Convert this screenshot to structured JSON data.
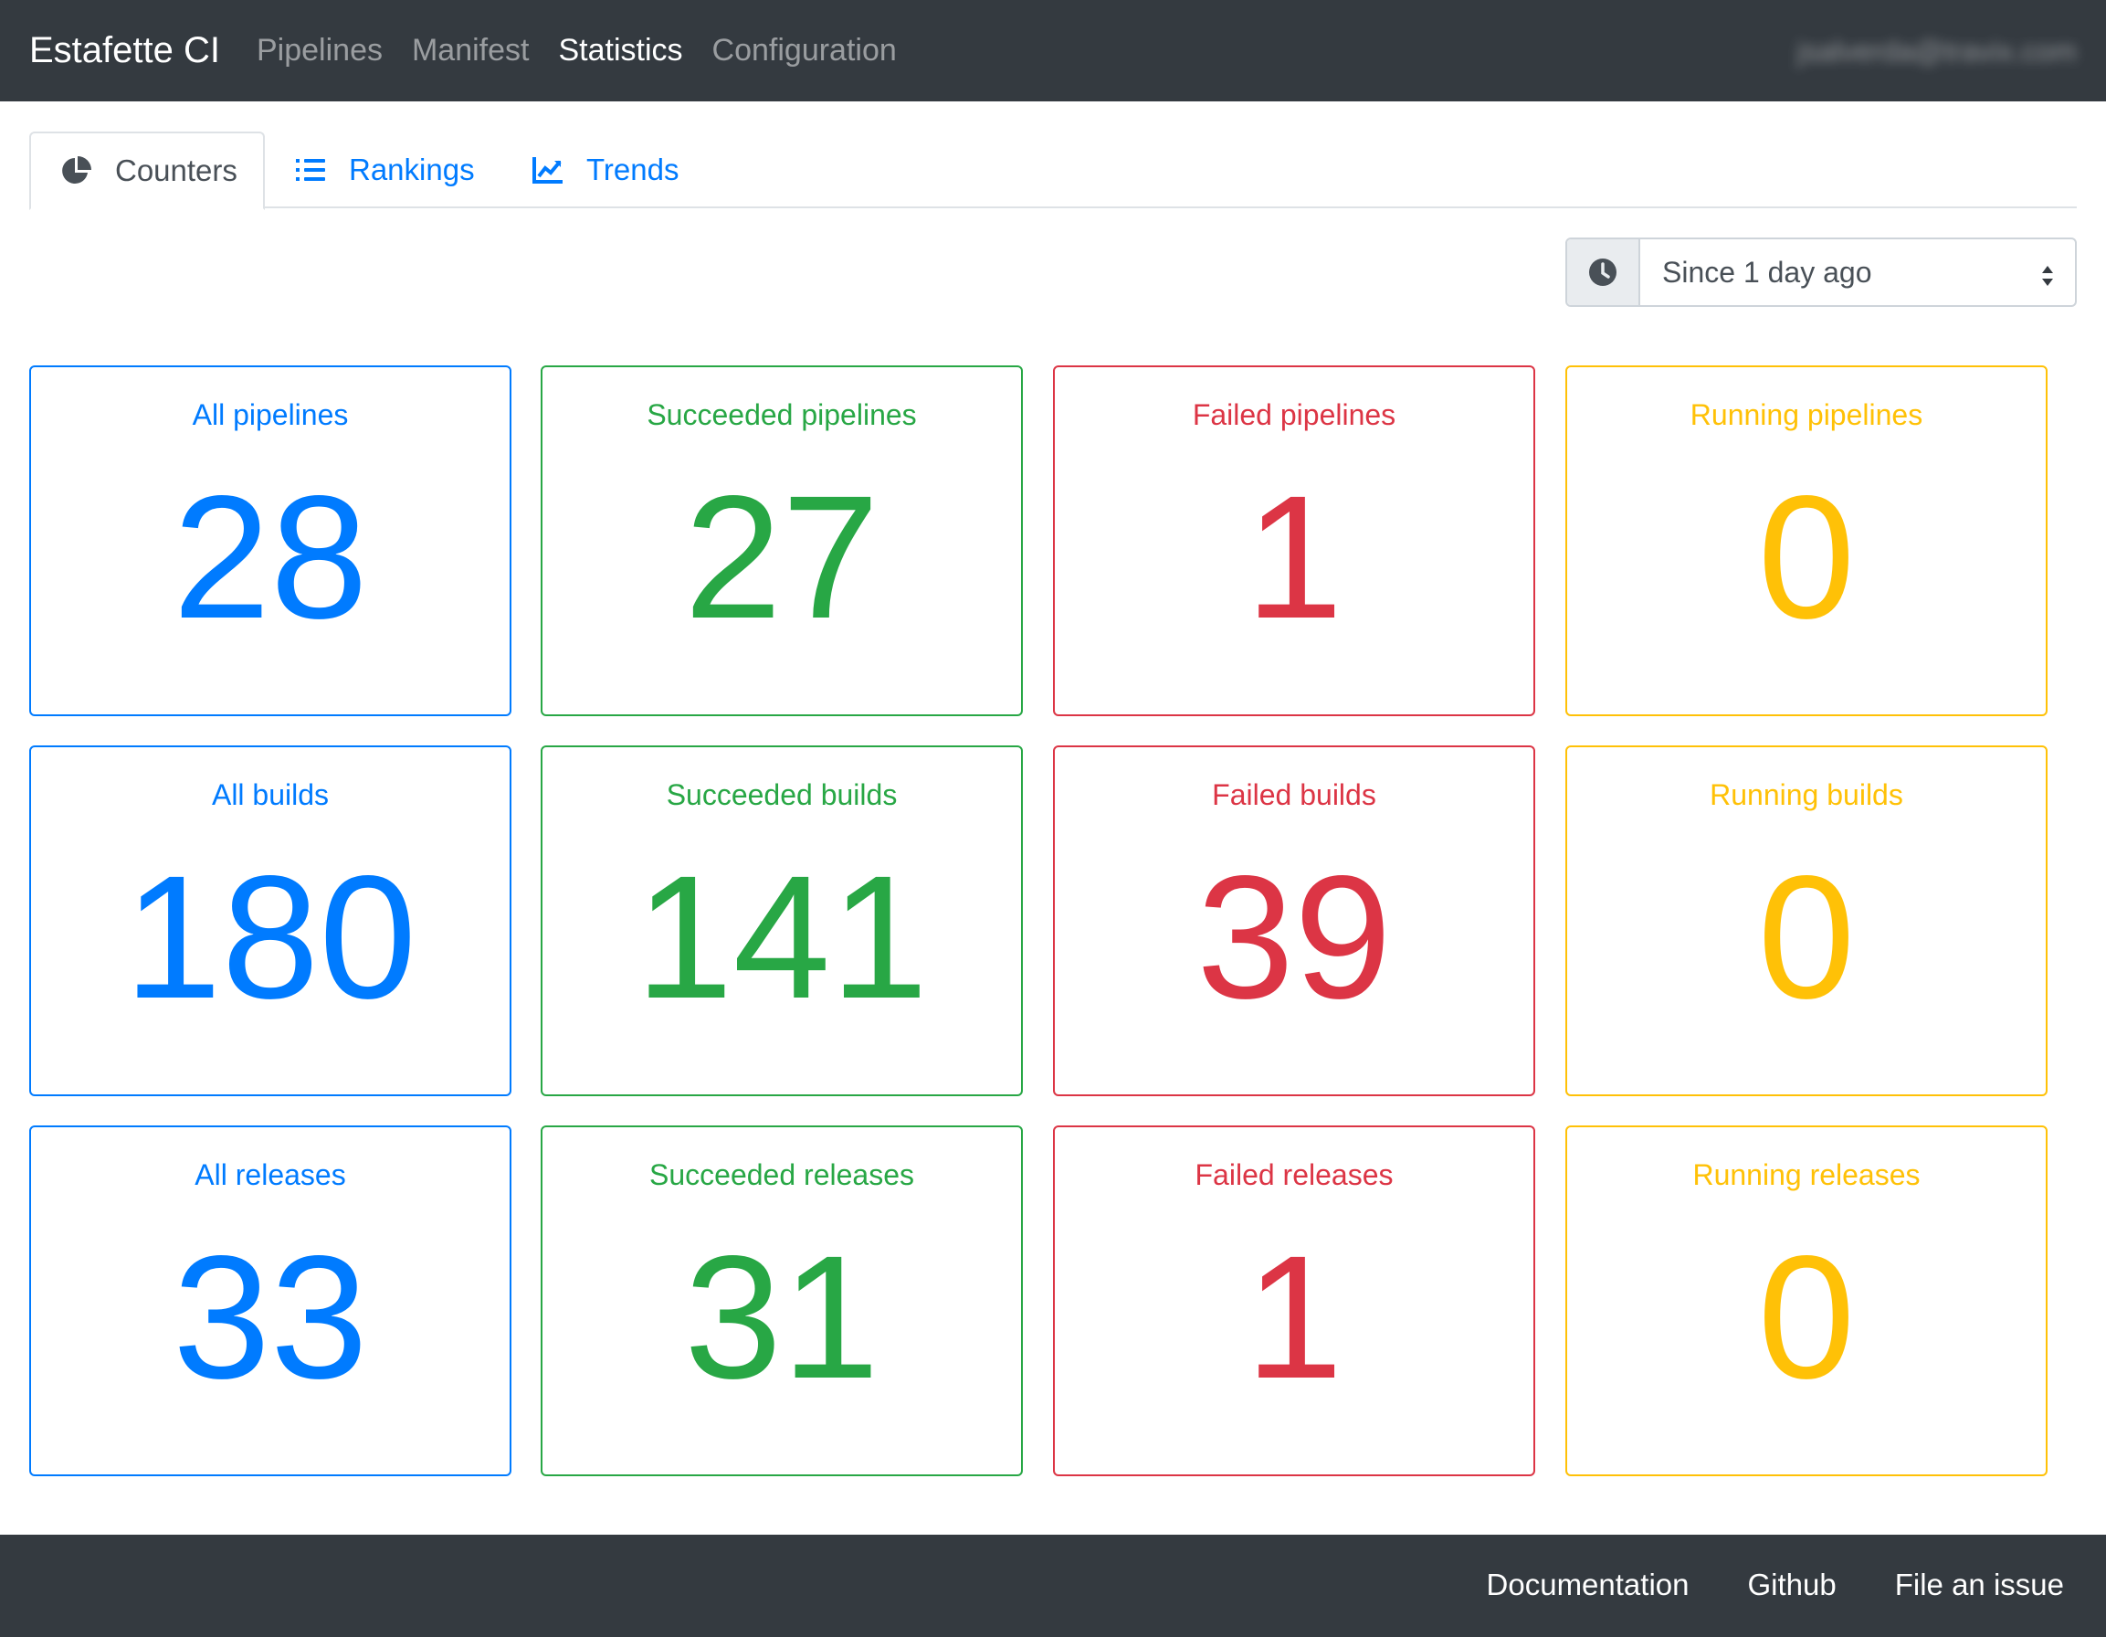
{
  "navbar": {
    "brand": "Estafette CI",
    "links": [
      "Pipelines",
      "Manifest",
      "Statistics",
      "Configuration"
    ],
    "active_link": "Statistics",
    "user_email": "jsalverda@travix.com"
  },
  "tabs": [
    {
      "label": "Counters",
      "icon": "pie-chart-icon",
      "active": true
    },
    {
      "label": "Rankings",
      "icon": "list-ol-icon",
      "active": false
    },
    {
      "label": "Trends",
      "icon": "line-chart-icon",
      "active": false
    }
  ],
  "filter": {
    "icon": "clock-icon",
    "selected": "Since 1 day ago"
  },
  "counters": [
    [
      {
        "label": "All pipelines",
        "value": "28",
        "color": "#007bff"
      },
      {
        "label": "Succeeded pipelines",
        "value": "27",
        "color": "#28a745"
      },
      {
        "label": "Failed pipelines",
        "value": "1",
        "color": "#dc3545"
      },
      {
        "label": "Running pipelines",
        "value": "0",
        "color": "#ffc107"
      }
    ],
    [
      {
        "label": "All builds",
        "value": "180",
        "color": "#007bff"
      },
      {
        "label": "Succeeded builds",
        "value": "141",
        "color": "#28a745"
      },
      {
        "label": "Failed builds",
        "value": "39",
        "color": "#dc3545"
      },
      {
        "label": "Running builds",
        "value": "0",
        "color": "#ffc107"
      }
    ],
    [
      {
        "label": "All releases",
        "value": "33",
        "color": "#007bff"
      },
      {
        "label": "Succeeded releases",
        "value": "31",
        "color": "#28a745"
      },
      {
        "label": "Failed releases",
        "value": "1",
        "color": "#dc3545"
      },
      {
        "label": "Running releases",
        "value": "0",
        "color": "#ffc107"
      }
    ]
  ],
  "footer": {
    "links": [
      "Documentation",
      "Github",
      "File an issue"
    ]
  },
  "colors": {
    "navbar_bg": "#343a40",
    "link_blue": "#007bff",
    "success": "#28a745",
    "danger": "#dc3545",
    "warning": "#ffc107"
  }
}
